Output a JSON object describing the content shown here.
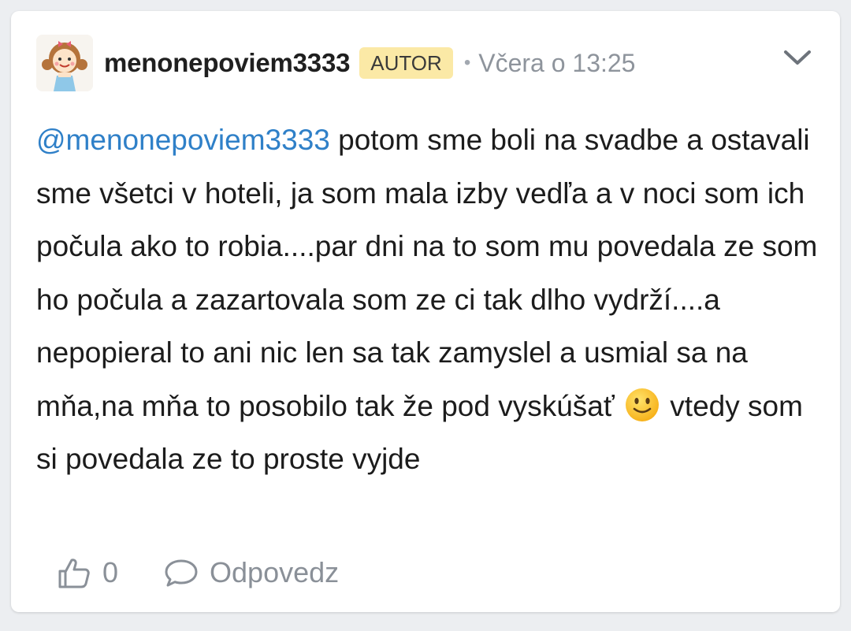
{
  "comment": {
    "author": "menonepoviem3333",
    "badge": "AUTOR",
    "separator": "•",
    "timestamp": "Včera o 13:25",
    "mention": "@menonepoviem3333",
    "text_parts": [
      " potom sme boli na svadbe a ostavali sme všetci v hoteli, ja som mala izby vedľa a v noci som ich počula ako to robia....par dni na to som mu povedala ze som ho počula a zazartovala som ze ci tak dlho vydrží....a nepopieral to ani nic len sa tak zamyslel a usmial sa na mňa,na mňa to posobilo tak že pod vyskúšať ",
      " vtedy som si povedala ze to proste vyjde"
    ],
    "emoji_icon": "slightly-smiling-face-emoji",
    "likes": "0",
    "reply_label": "Odpovedz"
  },
  "icons": {
    "avatar": "cartoon-girl-avatar",
    "menu": "chevron-down-icon",
    "like": "thumbs-up-icon",
    "reply": "speech-bubble-icon"
  },
  "colors": {
    "mention": "#2f80c8",
    "badge_bg": "#fbe9a6",
    "muted": "#8a9098",
    "background": "#eceef1"
  }
}
